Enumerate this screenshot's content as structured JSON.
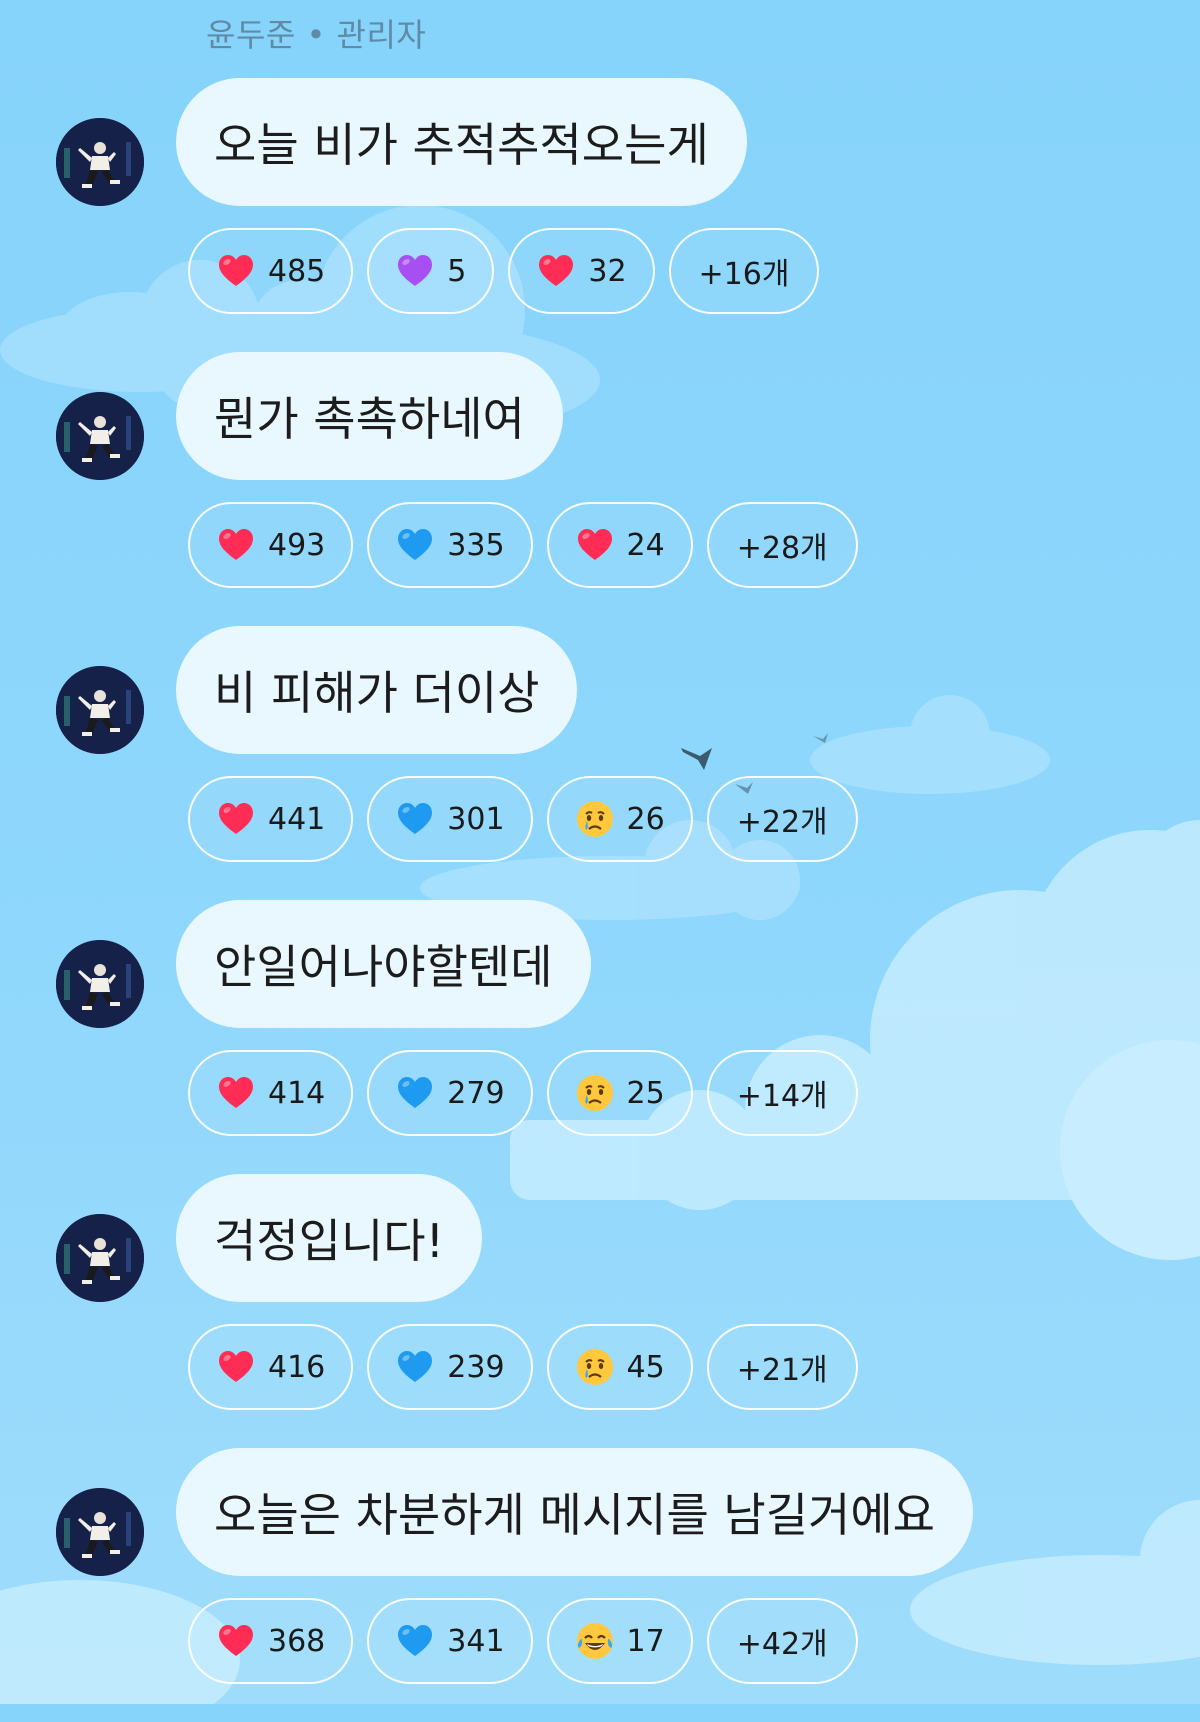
{
  "header": {
    "sender": "윤두준 • 관리자"
  },
  "messages": [
    {
      "text": "오늘 비가 추적추적오는게",
      "reactions": [
        {
          "icon": "red-heart-icon",
          "count": "485"
        },
        {
          "icon": "purple-heart-icon",
          "count": "5"
        },
        {
          "icon": "red-heart-icon",
          "count": "32"
        }
      ],
      "more": "+16개"
    },
    {
      "text": "뭔가 촉촉하네여",
      "reactions": [
        {
          "icon": "red-heart-icon",
          "count": "493"
        },
        {
          "icon": "blue-heart-icon",
          "count": "335"
        },
        {
          "icon": "red-heart-icon",
          "count": "24"
        }
      ],
      "more": "+28개"
    },
    {
      "text": "비 피해가 더이상",
      "reactions": [
        {
          "icon": "red-heart-icon",
          "count": "441"
        },
        {
          "icon": "blue-heart-icon",
          "count": "301"
        },
        {
          "icon": "crying-face-icon",
          "count": "26"
        }
      ],
      "more": "+22개"
    },
    {
      "text": "안일어나야할텐데",
      "reactions": [
        {
          "icon": "red-heart-icon",
          "count": "414"
        },
        {
          "icon": "blue-heart-icon",
          "count": "279"
        },
        {
          "icon": "crying-face-icon",
          "count": "25"
        }
      ],
      "more": "+14개"
    },
    {
      "text": "걱정입니다!",
      "reactions": [
        {
          "icon": "red-heart-icon",
          "count": "416"
        },
        {
          "icon": "blue-heart-icon",
          "count": "239"
        },
        {
          "icon": "crying-face-icon",
          "count": "45"
        }
      ],
      "more": "+21개"
    },
    {
      "text": "오늘은 차분하게 메시지를 남길거에요",
      "reactions": [
        {
          "icon": "red-heart-icon",
          "count": "368"
        },
        {
          "icon": "blue-heart-icon",
          "count": "341"
        },
        {
          "icon": "tears-of-joy-icon",
          "count": "17"
        }
      ],
      "more": "+42개"
    }
  ],
  "colors": {
    "red_heart": "#ff2d55",
    "purple_heart": "#a74ff2",
    "blue_heart": "#1e9bf0",
    "emoji_face": "#ffc83d"
  }
}
